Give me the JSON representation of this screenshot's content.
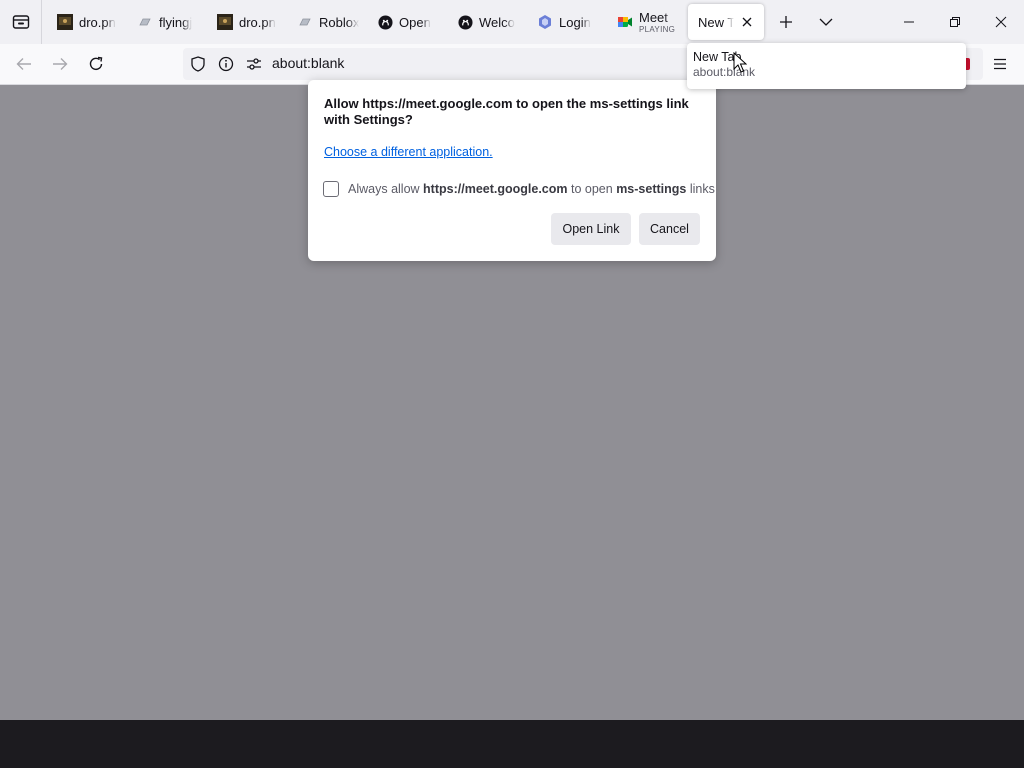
{
  "tabs": [
    {
      "label": "dro.pn",
      "icon": "image-thumbnail-icon"
    },
    {
      "label": "flyingj",
      "icon": "cloud-file-icon"
    },
    {
      "label": "dro.pn",
      "icon": "image-thumbnail-icon"
    },
    {
      "label": "Roblox",
      "icon": "cloud-file-icon"
    },
    {
      "label": "Open",
      "icon": "github-icon"
    },
    {
      "label": "Welco",
      "icon": "github-icon"
    },
    {
      "label": "Login",
      "icon": "hexagon-logo-icon"
    },
    {
      "label": "Meet",
      "sublabel": "PLAYING",
      "icon": "google-meet-icon"
    },
    {
      "label": "New T",
      "icon": "none",
      "active": true
    }
  ],
  "url": "about:blank",
  "dialog": {
    "title": "Allow https://meet.google.com to open the ms-settings link with Settings?",
    "choose_link": "Choose a different application.",
    "always_allow_prefix": "Always allow",
    "always_allow_site": "https://meet.google.com",
    "always_allow_middle": "to open",
    "always_allow_scheme": "ms-settings",
    "always_allow_suffix": "links",
    "always_allow_checked": false,
    "open_button": "Open Link",
    "cancel_button": "Cancel"
  },
  "tooltip": {
    "title": "New Tab",
    "url": "about:blank"
  },
  "colors": {
    "content_bg": "#908f95",
    "link": "#0061e0",
    "taskbar": "#1c1b1f"
  }
}
